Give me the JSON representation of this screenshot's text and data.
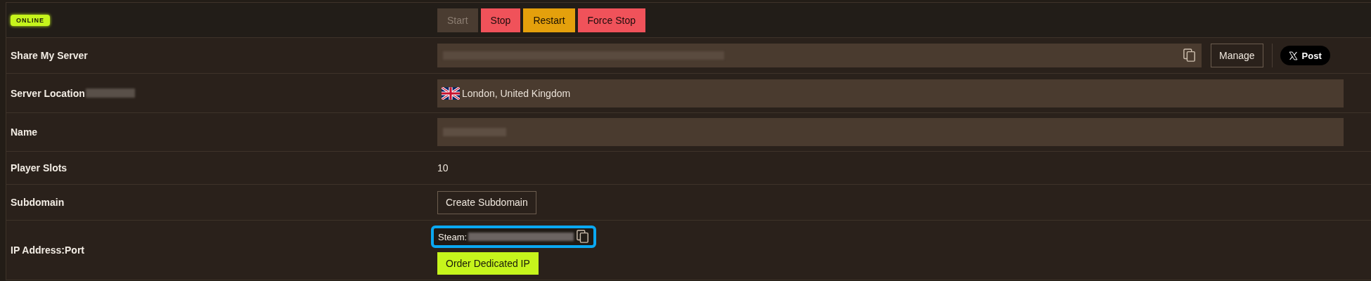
{
  "status": {
    "label": "ONLINE"
  },
  "power_buttons": [
    {
      "label": "Start",
      "disabled": true,
      "kind": "neutral"
    },
    {
      "label": "Stop",
      "disabled": false,
      "kind": "danger"
    },
    {
      "label": "Restart",
      "disabled": false,
      "kind": "warning"
    },
    {
      "label": "Force Stop",
      "disabled": false,
      "kind": "danger"
    }
  ],
  "rows": [
    {
      "kind": "share",
      "label": "Share My Server",
      "manage": "Manage",
      "post": "Post"
    },
    {
      "kind": "location",
      "label": "Server Location",
      "value": "London, United Kingdom"
    },
    {
      "kind": "field",
      "label": "Name"
    },
    {
      "kind": "text",
      "label": "Player Slots",
      "value": "10"
    },
    {
      "kind": "button",
      "label": "Subdomain",
      "button": "Create Subdomain"
    },
    {
      "kind": "ip",
      "label": "IP Address:Port",
      "prefix": "Steam:",
      "highlighted": true,
      "button": "Order Dedicated IP"
    }
  ]
}
